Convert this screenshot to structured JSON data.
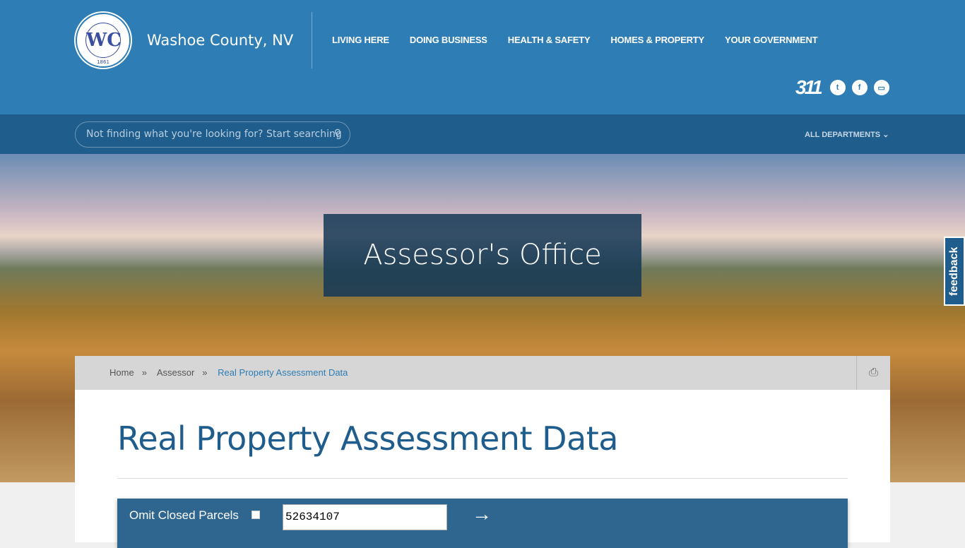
{
  "header": {
    "logo_text": "WASHOE COUNTY, NEVADA",
    "logo_year": "1861",
    "logo_monogram": "WC",
    "site_name": "Washoe County, NV",
    "nav": [
      "LIVING HERE",
      "DOING BUSINESS",
      "HEALTH & SAFETY",
      "HOMES & PROPERTY",
      "YOUR GOVERNMENT"
    ],
    "social": {
      "phone_label": "311",
      "icons": [
        "twitter-icon",
        "facebook-icon",
        "tv-icon"
      ]
    }
  },
  "search": {
    "placeholder": "Not finding what you're looking for? Start searching",
    "departments_label": "ALL DEPARTMENTS"
  },
  "hero": {
    "title": "Assessor's Office"
  },
  "feedback_label": "feedback",
  "breadcrumb": [
    "Home",
    "Assessor",
    "Real Property Assessment Data"
  ],
  "breadcrumb_sep": "»",
  "page": {
    "title": "Real Property Assessment Data"
  },
  "form": {
    "omit_label": "Omit Closed Parcels",
    "omit_checked": false,
    "parcel_value": "52634107"
  },
  "colors": {
    "header": "#2e7db5",
    "subbar": "#1f5d8c",
    "form": "#2e6690"
  }
}
